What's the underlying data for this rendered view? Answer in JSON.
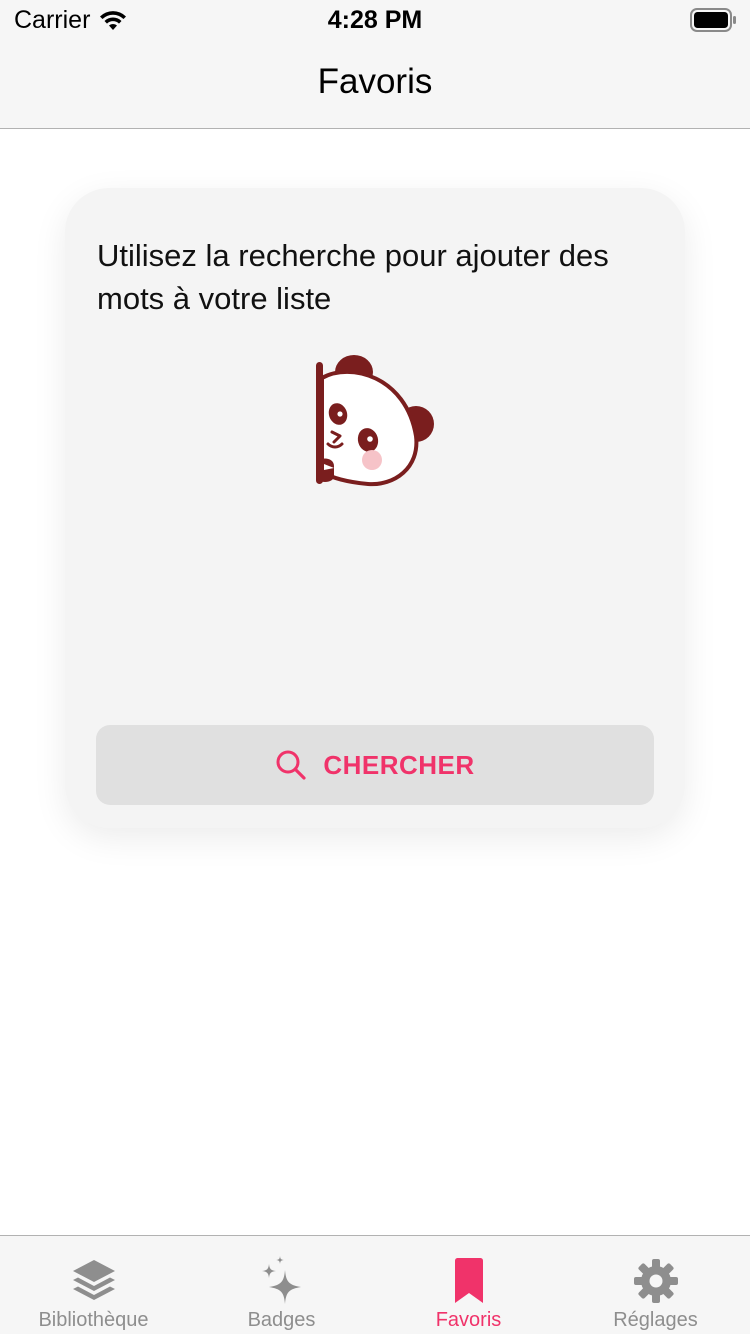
{
  "status_bar": {
    "carrier": "Carrier",
    "time": "4:28 PM",
    "icons": [
      "wifi-icon",
      "battery-icon"
    ]
  },
  "nav": {
    "title": "Favoris"
  },
  "card": {
    "message": "Utilisez la recherche pour ajouter des mots à votre liste",
    "illustration": "panda-peeking-icon",
    "search_button": {
      "label": "CHERCHER",
      "icon": "search-icon"
    }
  },
  "tab_bar": {
    "tabs": [
      {
        "label": "Bibliothèque",
        "icon": "layers-icon",
        "active": false
      },
      {
        "label": "Badges",
        "icon": "sparkles-icon",
        "active": false
      },
      {
        "label": "Favoris",
        "icon": "bookmark-icon",
        "active": true
      },
      {
        "label": "Réglages",
        "icon": "gear-icon",
        "active": false
      }
    ]
  },
  "colors": {
    "accent": "#f0336a",
    "inactive": "#8e8e8e",
    "bar_background": "#f6f6f6",
    "card_background": "#f4f4f4",
    "button_background": "#e0e0e0",
    "panda_brown": "#7a1e1e",
    "panda_blush": "#f6c3c8"
  }
}
